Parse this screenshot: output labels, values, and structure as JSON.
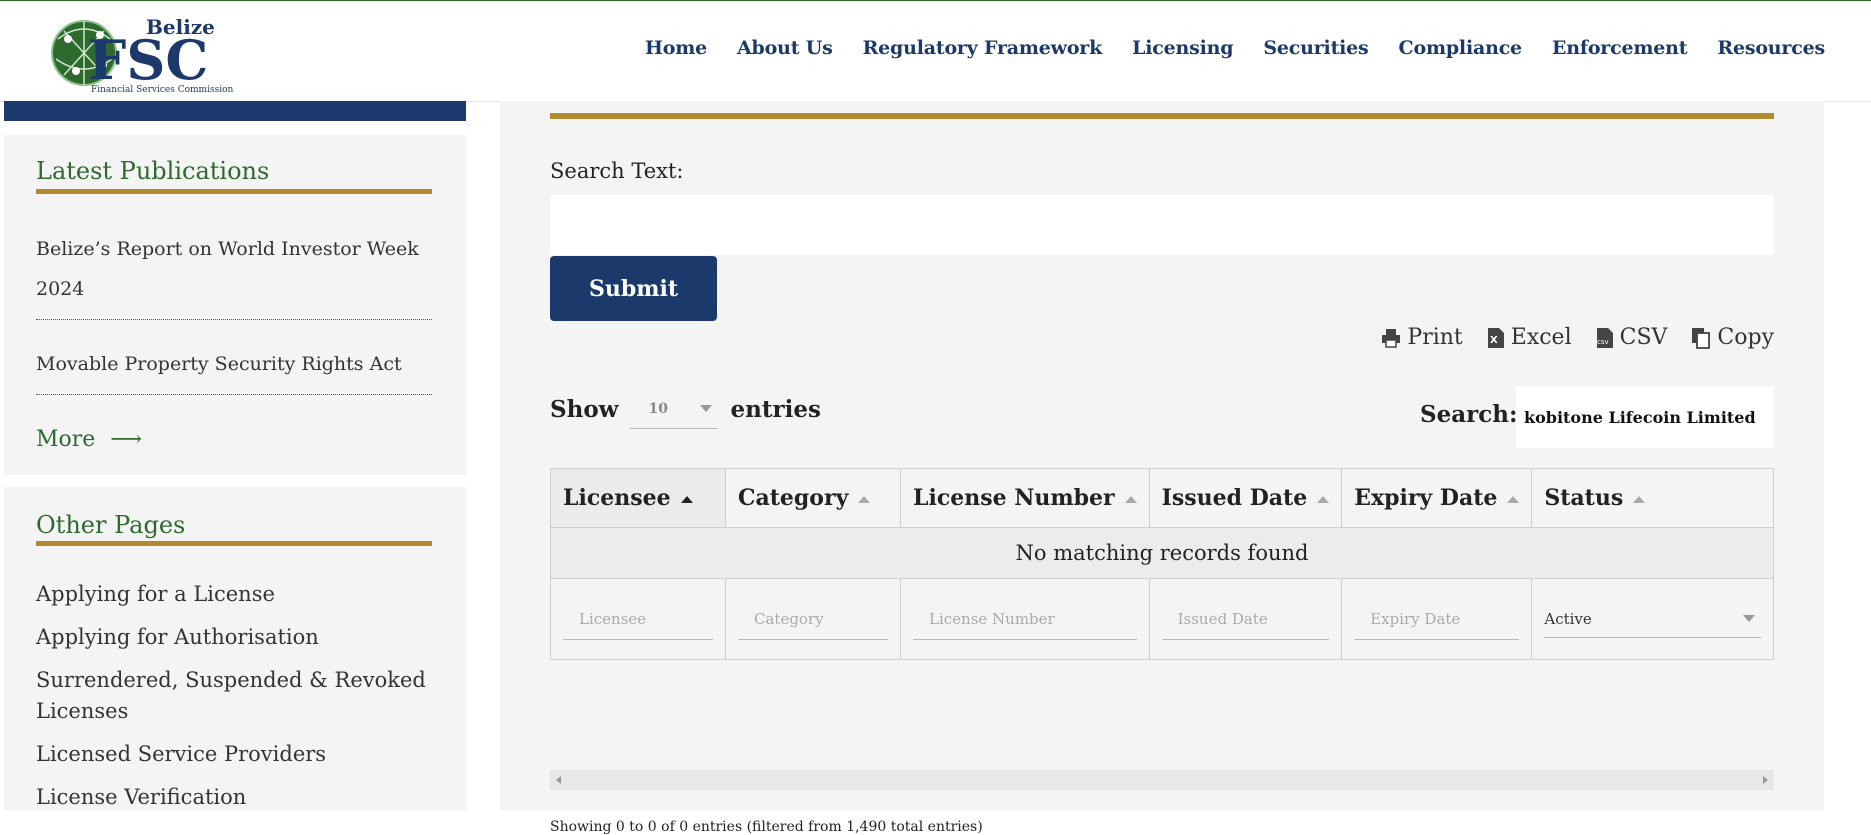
{
  "logo": {
    "top_text": "Belize",
    "main_text": "FSC",
    "subtitle": "Financial Services Commission"
  },
  "nav": [
    "Home",
    "About Us",
    "Regulatory Framework",
    "Licensing",
    "Securities",
    "Compliance",
    "Enforcement",
    "Resources"
  ],
  "sidebar": {
    "publications_title": "Latest Publications",
    "publications": [
      "Belize’s Report on World Investor Week 2024",
      "Movable Property Security Rights Act"
    ],
    "more_label": "More",
    "other_title": "Other Pages",
    "other_pages": [
      "Applying for a License",
      "Applying for Authorisation",
      "Surrendered, Suspended & Revoked Licenses",
      "Licensed Service Providers",
      "License Verification"
    ]
  },
  "form": {
    "search_label": "Search Text:",
    "search_value": "",
    "submit_label": "Submit"
  },
  "exports": {
    "print": "Print",
    "excel": "Excel",
    "csv": "CSV",
    "copy": "Copy"
  },
  "table_controls": {
    "show_label": "Show",
    "entries_value": "10",
    "entries_label": "entries",
    "search_label": "Search:",
    "search_value": "kobitone Lifecoin Limited"
  },
  "table": {
    "columns": [
      "Licensee",
      "Category",
      "License Number",
      "Issued Date",
      "Expiry Date",
      "Status"
    ],
    "empty_message": "No matching records found",
    "filters": [
      "Licensee",
      "Category",
      "License Number",
      "Issued Date",
      "Expiry Date"
    ],
    "status_filter": "Active"
  },
  "info": "Showing 0 to 0 of 0 entries (filtered from 1,490 total entries)",
  "colors": {
    "brand_navy": "#1b3a6b",
    "brand_green": "#2e6a2e",
    "gold": "#b08a2e"
  }
}
